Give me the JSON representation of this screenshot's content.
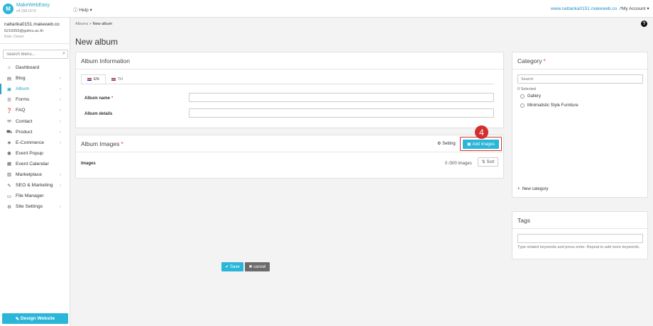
{
  "app": {
    "logo_letter": "M",
    "name": "MakeWebEasy",
    "version": "v4.158.1673"
  },
  "topbar": {
    "help_label": "Help",
    "site_url": "www.nattarika0151.makeweb.co",
    "account_label": "My Account"
  },
  "user": {
    "name": "nattarika0151.makeweb.co",
    "email": "6216055@gulinu.ac.th",
    "role": "Role: Owner"
  },
  "sidebar": {
    "search_placeholder": "Search Menu...",
    "items": [
      {
        "label": "Dashboard",
        "icon": "home-icon",
        "glyph": "⌂",
        "chevron": false
      },
      {
        "label": "Blog",
        "icon": "document-icon",
        "glyph": "▤",
        "chevron": true
      },
      {
        "label": "Album",
        "icon": "image-icon",
        "glyph": "▣",
        "chevron": true,
        "active": true
      },
      {
        "label": "Forms",
        "icon": "form-icon",
        "glyph": "☰",
        "chevron": true
      },
      {
        "label": "FAQ",
        "icon": "faq-icon",
        "glyph": "❓",
        "chevron": true
      },
      {
        "label": "Contact",
        "icon": "envelope-icon",
        "glyph": "✉",
        "chevron": true
      },
      {
        "label": "Product",
        "icon": "cart-icon",
        "glyph": "⛟",
        "chevron": true
      },
      {
        "label": "E-Commerce",
        "icon": "commerce-icon",
        "glyph": "◈",
        "chevron": true
      },
      {
        "label": "Event Popup",
        "icon": "popup-icon",
        "glyph": "◉",
        "chevron": false
      },
      {
        "label": "Event Calendar",
        "icon": "calendar-icon",
        "glyph": "▦",
        "chevron": false
      },
      {
        "label": "Marketplace",
        "icon": "marketplace-icon",
        "glyph": "▥",
        "chevron": true
      },
      {
        "label": "SEO & Marketing",
        "icon": "seo-icon",
        "glyph": "✎",
        "chevron": true
      },
      {
        "label": "File Manager",
        "icon": "folder-icon",
        "glyph": "▭",
        "chevron": false
      },
      {
        "label": "Site Settings",
        "icon": "gear-icon",
        "glyph": "⚙",
        "chevron": true
      }
    ],
    "design_button": "Design Website"
  },
  "breadcrumb": {
    "parent": "Albums",
    "separator": ">",
    "current": "New album"
  },
  "page_title": "New album",
  "album_info": {
    "title": "Album Information",
    "tabs": [
      {
        "label": "EN",
        "active": true
      },
      {
        "label": "TH",
        "active": false
      }
    ],
    "fields": [
      {
        "label": "Album name",
        "required": true,
        "value": ""
      },
      {
        "label": "Album details",
        "required": false,
        "value": ""
      }
    ]
  },
  "album_images": {
    "title": "Album Images",
    "setting_label": "Setting",
    "add_button": "Add images",
    "step_number": "4",
    "images_label": "Images",
    "images_count": "0 /300 images",
    "sort_button": "Sort"
  },
  "actions": {
    "save": "Save",
    "cancel": "cancel"
  },
  "category": {
    "title": "Category",
    "search_placeholder": "Search",
    "selected_text": "0 Selected",
    "options": [
      "Gallery",
      "Minimalistic Style Furniture"
    ],
    "new_category": "New category"
  },
  "tags": {
    "title": "Tags",
    "value": "",
    "help_text": "Type related keywords and press enter. Repeat to add more keywords."
  },
  "colors": {
    "accent": "#29b6d8",
    "highlight": "#d32f2f",
    "required": "#e74c3c"
  }
}
